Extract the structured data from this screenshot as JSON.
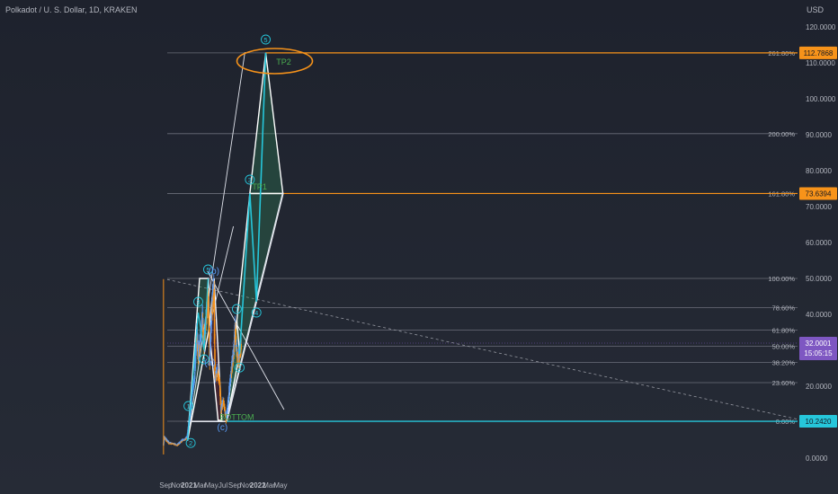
{
  "header": {
    "symbol_line": "Polkadot / U. S. Dollar, 1D, KRAKEN",
    "currency": "USD"
  },
  "chart_data": {
    "type": "line",
    "title": "",
    "ylim": [
      0,
      120
    ],
    "y_ticks": [
      "120.0000",
      "110.0000",
      "100.0000",
      "90.0000",
      "80.0000",
      "70.0000",
      "60.0000",
      "50.0000",
      "40.0000",
      "30.0000",
      "20.0000",
      "10.0000",
      "0.0000"
    ],
    "x_ticks": [
      "Sep",
      "Nov",
      "2021",
      "Mar",
      "May",
      "Jul",
      "Sep",
      "Nov",
      "2022",
      "Mar",
      "May"
    ],
    "x_range": [
      "2020-08-15",
      "2022-05-20"
    ],
    "fib_levels": [
      {
        "label": "261.80%",
        "value": 112.7868
      },
      {
        "label": "200.00%",
        "value": 90.3
      },
      {
        "label": "161.80%",
        "value": 73.6394
      },
      {
        "label": "100.00%",
        "value": 50.0
      },
      {
        "label": "78.60%",
        "value": 41.9
      },
      {
        "label": "61.80%",
        "value": 35.6
      },
      {
        "label": "50.00%",
        "value": 31.1
      },
      {
        "label": "38.20%",
        "value": 26.6
      },
      {
        "label": "23.60%",
        "value": 21.0
      },
      {
        "label": "0.00%",
        "value": 10.242
      }
    ],
    "price_badges": [
      {
        "text": "112.7868",
        "value": 112.7868,
        "color": "#f7931a"
      },
      {
        "text": "73.6394",
        "value": 73.6394,
        "color": "#f7931a"
      },
      {
        "text": "10.2420",
        "value": 10.242,
        "color": "#26c6da"
      }
    ],
    "current_price": {
      "price": "32.0001",
      "countdown": "15:05:15",
      "value": 32.0001,
      "color": "#7e57c2"
    },
    "annotations": {
      "tp2": "TP2",
      "tp1": "TP1",
      "bottom": "BOTTOM"
    },
    "wave_labels": [
      {
        "text": "1",
        "date": "2020-12-30",
        "value": 14.5,
        "style": "circle"
      },
      {
        "text": "2",
        "date": "2021-01-11",
        "value": 4.2,
        "style": "circle"
      },
      {
        "text": "3",
        "date": "2021-02-20",
        "value": 43.5,
        "style": "circle"
      },
      {
        "text": "4",
        "date": "2021-03-23",
        "value": 27.5,
        "style": "circle"
      },
      {
        "text": "5",
        "date": "2021-04-13",
        "value": 52.5,
        "style": "circle"
      },
      {
        "text": "(a)",
        "date": "2021-04-23",
        "value": 26.5,
        "style": "paren"
      },
      {
        "text": "(b)",
        "date": "2021-05-14",
        "value": 52.0,
        "style": "paren"
      },
      {
        "text": "(c)",
        "date": "2021-06-28",
        "value": 8.5,
        "style": "paren"
      },
      {
        "text": "1",
        "date": "2021-09-12",
        "value": 41.5,
        "style": "circle"
      },
      {
        "text": "2",
        "date": "2021-09-27",
        "value": 25.2,
        "style": "circle"
      },
      {
        "text": "3",
        "date": "2021-11-20",
        "value": 77.5,
        "style": "circle"
      },
      {
        "text": "4",
        "date": "2021-12-25",
        "value": 40.5,
        "style": "circle"
      },
      {
        "text": "5",
        "date": "2022-02-12",
        "value": 116.5,
        "style": "circle"
      }
    ],
    "colors": {
      "accent": "#f7931a",
      "wave": "#26c6da",
      "bottom": "#4caf50",
      "up_fill": "#2e7d57",
      "down_fill": "#7a1f2e"
    },
    "price_series": [
      [
        "2020-08-20",
        3.5
      ],
      [
        "2020-08-25",
        5.8
      ],
      [
        "2020-09-01",
        5.3
      ],
      [
        "2020-09-10",
        4.8
      ],
      [
        "2020-09-20",
        4.2
      ],
      [
        "2020-10-01",
        4.1
      ],
      [
        "2020-10-15",
        4.0
      ],
      [
        "2020-11-01",
        3.6
      ],
      [
        "2020-11-15",
        4.2
      ],
      [
        "2020-12-01",
        5.0
      ],
      [
        "2020-12-15",
        5.2
      ],
      [
        "2020-12-25",
        6.0
      ],
      [
        "2021-01-01",
        9.0
      ],
      [
        "2021-01-10",
        12.5
      ],
      [
        "2021-01-20",
        18.0
      ],
      [
        "2021-02-01",
        22.0
      ],
      [
        "2021-02-14",
        35.0
      ],
      [
        "2021-02-22",
        28.5
      ],
      [
        "2021-03-05",
        33.0
      ],
      [
        "2021-03-15",
        40.0
      ],
      [
        "2021-03-24",
        31.0
      ],
      [
        "2021-04-05",
        39.0
      ],
      [
        "2021-04-14",
        45.0
      ],
      [
        "2021-04-23",
        27.5
      ],
      [
        "2021-05-05",
        42.0
      ],
      [
        "2021-05-15",
        47.0
      ],
      [
        "2021-05-21",
        22.0
      ],
      [
        "2021-06-01",
        24.0
      ],
      [
        "2021-06-15",
        21.0
      ],
      [
        "2021-06-22",
        13.0
      ],
      [
        "2021-07-05",
        16.0
      ],
      [
        "2021-07-20",
        11.0
      ],
      [
        "2021-08-01",
        17.0
      ],
      [
        "2021-08-15",
        24.0
      ],
      [
        "2021-08-28",
        29.0
      ],
      [
        "2021-09-05",
        36.0
      ],
      [
        "2021-09-12",
        30.0
      ],
      [
        "2021-09-22",
        26.5
      ],
      [
        "2021-10-01",
        30.5
      ],
      [
        "2021-10-05",
        32.0
      ]
    ]
  }
}
